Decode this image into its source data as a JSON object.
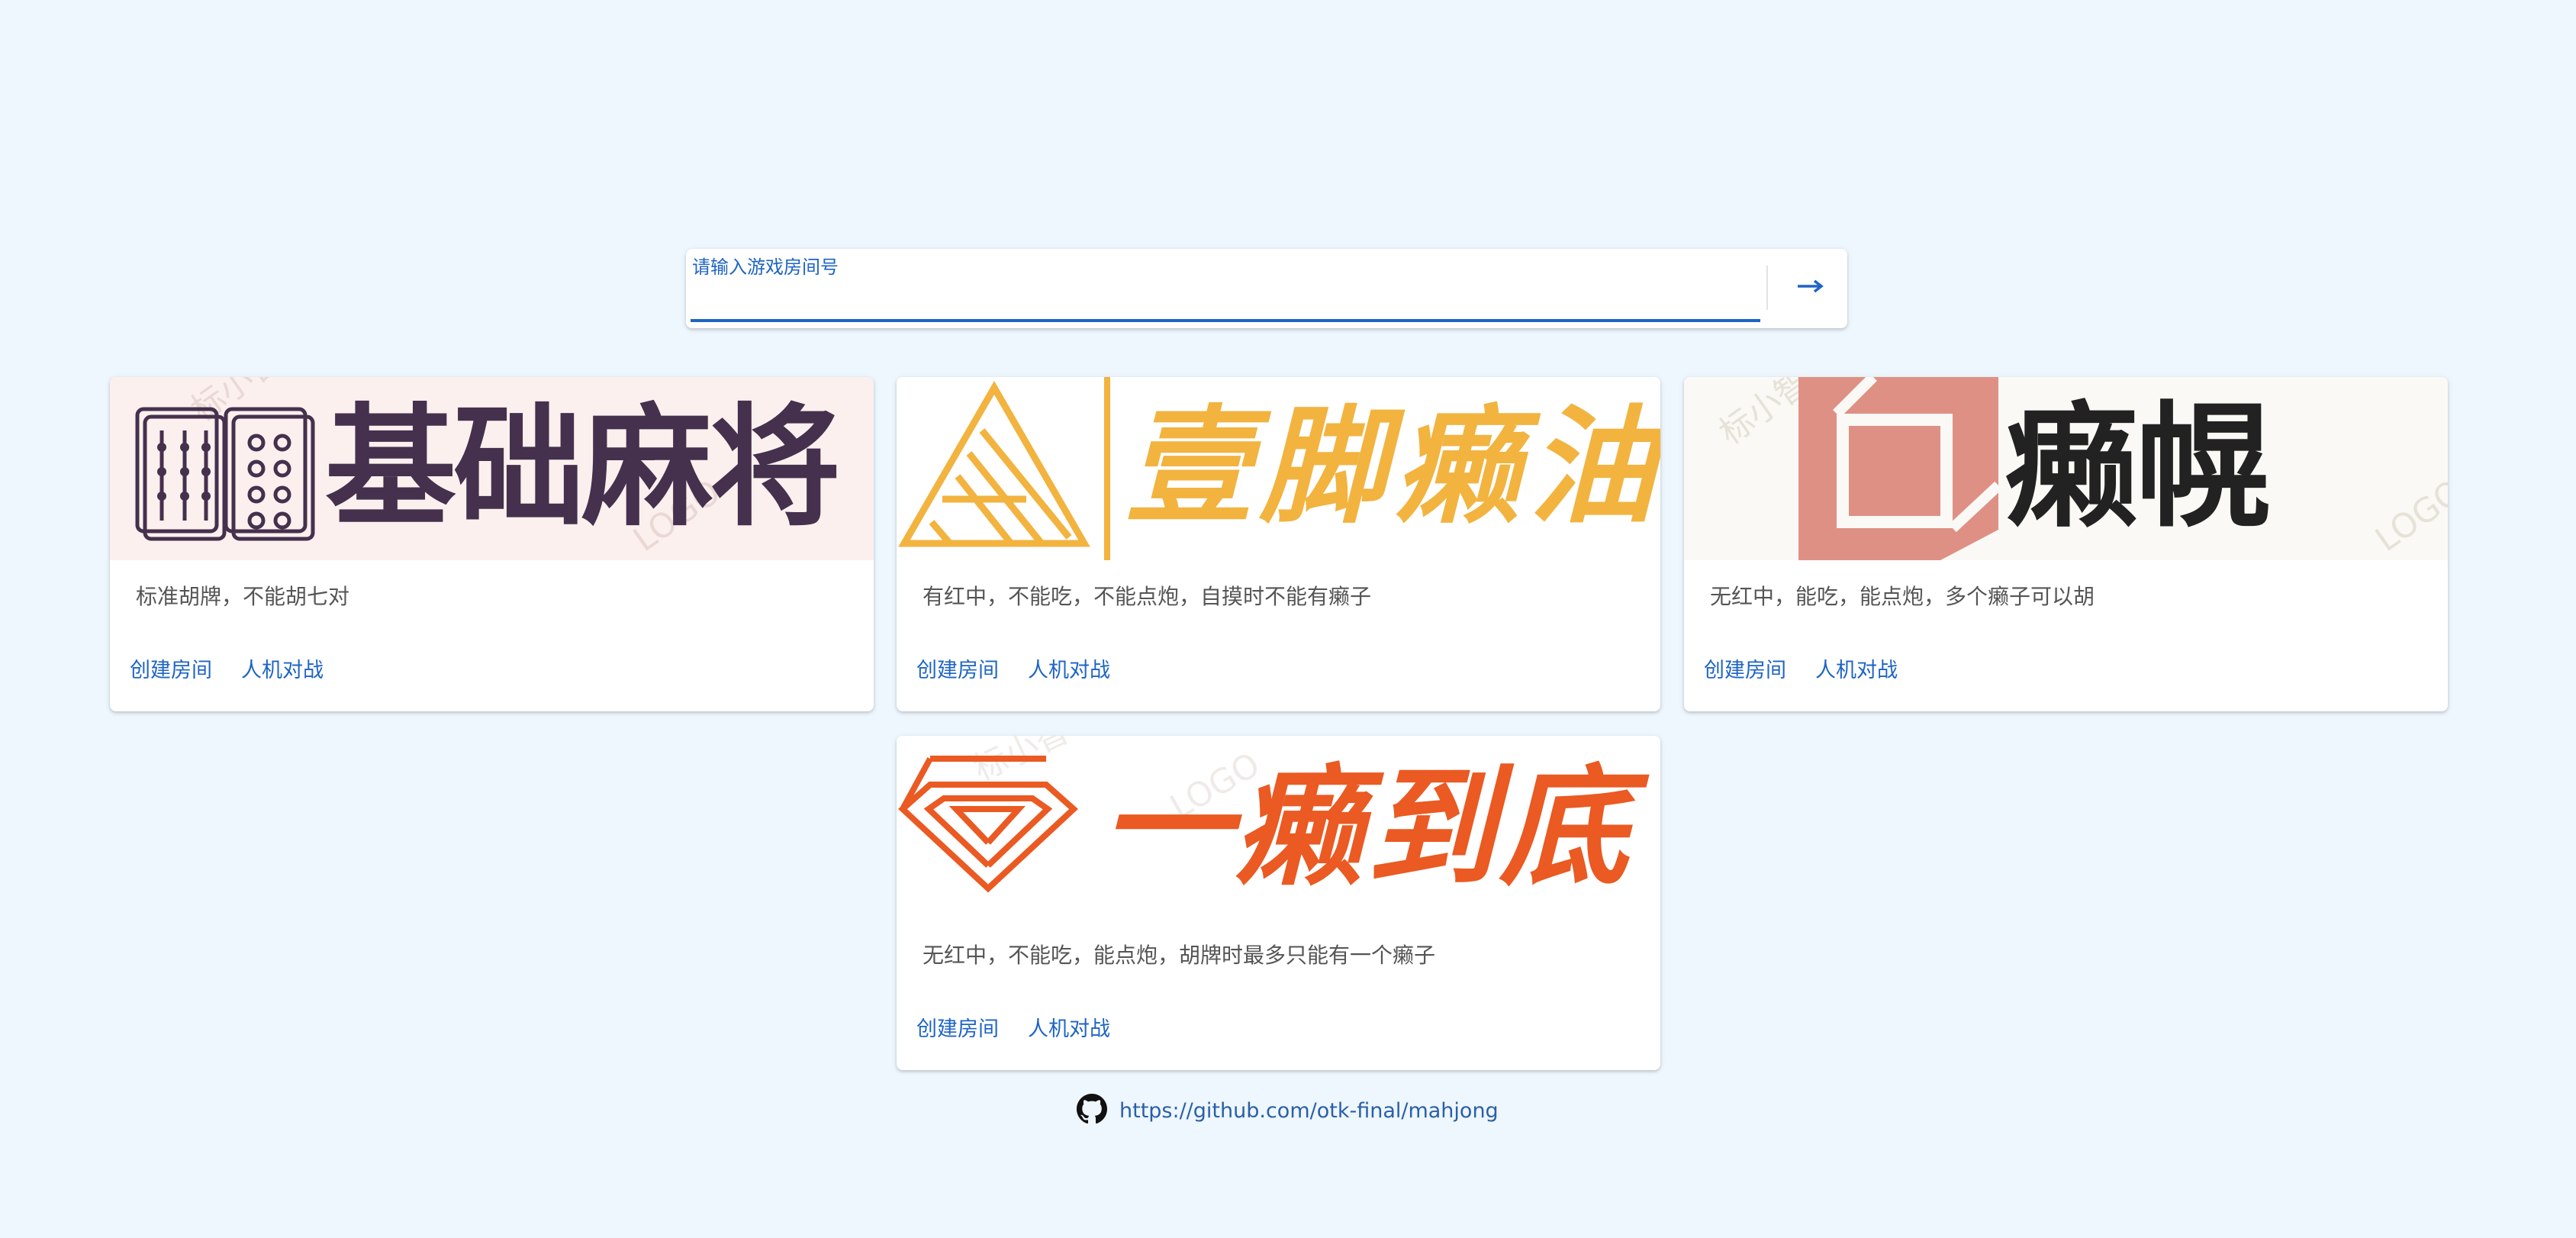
{
  "search": {
    "label": "请输入游戏房间号",
    "value": "",
    "accent_color": "#1e64c4",
    "submit_icon": "arrow-right-icon"
  },
  "cards": [
    {
      "title": "基础麻将",
      "title_color": "#45304d",
      "banner_bg": "#fbf0ee",
      "logo_icon": "mahjong-tiles-icon",
      "description": "标准胡牌，不能胡七对",
      "create_label": "创建房间",
      "ai_label": "人机对战"
    },
    {
      "title": "壹脚癞油",
      "title_color": "#f2b33f",
      "banner_bg": "#ffffff",
      "logo_icon": "striped-triangle-icon",
      "description": "有红中，不能吃，不能点炮，自摸时不能有癞子",
      "create_label": "创建房间",
      "ai_label": "人机对战"
    },
    {
      "title": "癞幌",
      "title_color": "#222222",
      "banner_bg": "#faf9f5",
      "logo_icon": "cube-icon",
      "description": "无红中，能吃，能点炮，多个癞子可以胡",
      "create_label": "创建房间",
      "ai_label": "人机对战"
    },
    {
      "title": "一癞到底",
      "title_color": "#ea5a22",
      "banner_bg": "#ffffff",
      "logo_icon": "nested-diamond-icon",
      "description": "无红中，不能吃，能点炮，胡牌时最多只能有一个癞子",
      "create_label": "创建房间",
      "ai_label": "人机对战"
    }
  ],
  "footer": {
    "icon": "github-icon",
    "link_text": "https://github.com/otk-final/mahjong"
  },
  "colors": {
    "page_background": "#eef6fe",
    "link": "#1e64c4"
  }
}
